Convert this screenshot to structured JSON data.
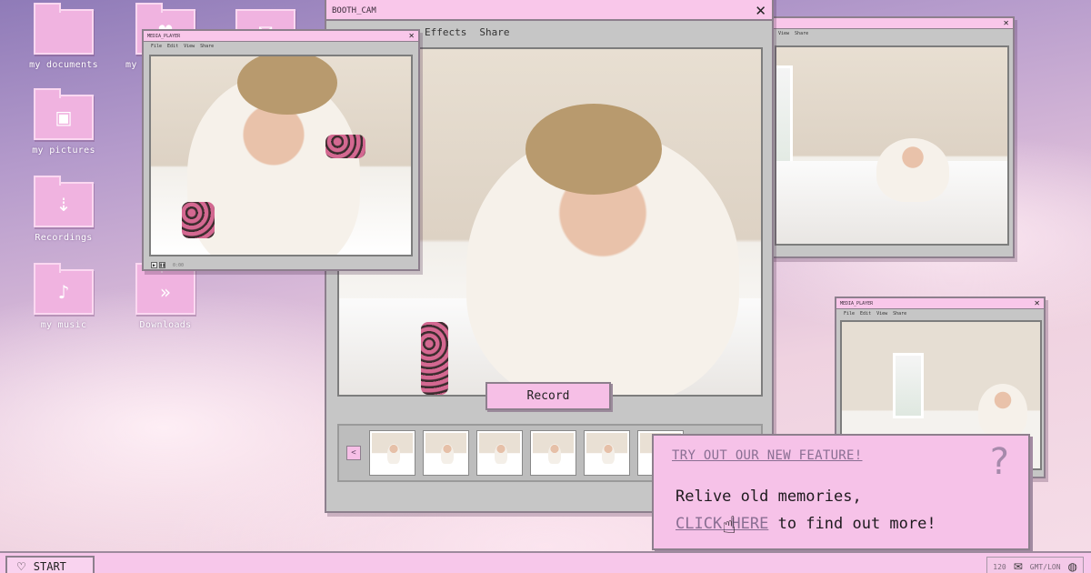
{
  "desktop": {
    "icons": [
      {
        "label": "my documents",
        "icon": "folder-icon"
      },
      {
        "label": "my",
        "icon": "heart-folder-icon"
      },
      {
        "label": "",
        "icon": "mail-icon"
      },
      {
        "label": "my pictures",
        "icon": "picture-folder-icon"
      },
      {
        "label": "Recordings",
        "icon": "download-folder-icon"
      },
      {
        "label": "my music",
        "icon": "music-folder-icon"
      },
      {
        "label": "Downloads",
        "icon": "chevrons-down-folder-icon"
      }
    ]
  },
  "main_window": {
    "title": "BOOTH_CAM",
    "menu": [
      "Effects",
      "Share"
    ],
    "record_label": "Record",
    "filmstrip_arrow": "<"
  },
  "player_left": {
    "title": "MEDIA_PLAYER",
    "menu": [
      "File",
      "Edit",
      "View",
      "Share"
    ],
    "time": "0:00"
  },
  "player_right_top": {
    "title": "",
    "menu": [
      "View",
      "Share"
    ]
  },
  "player_right_bottom": {
    "title": "MEDIA_PLAYER",
    "menu": [
      "File",
      "Edit",
      "View",
      "Share"
    ]
  },
  "popup": {
    "header": "TRY OUT OUR NEW FEATURE!",
    "line1": "Relive old memories,",
    "link": "CLICK HERE",
    "line2_suffix": " to find out more!",
    "help_glyph": "?"
  },
  "taskbar": {
    "start_label": "START",
    "tray_count": "120",
    "tray_timezone": "GMT/LON"
  },
  "colors": {
    "window_pink": "#f9c7ea",
    "window_gray": "#c6c6c6",
    "link_purple": "#8a6f93"
  }
}
